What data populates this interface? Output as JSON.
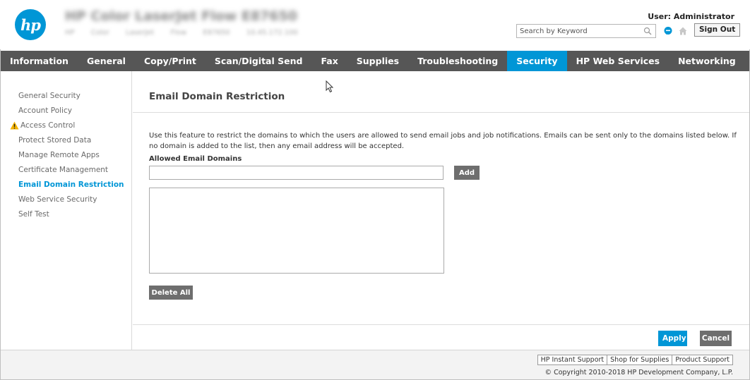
{
  "header": {
    "logo_text": "hp",
    "device_name": "HP Color LaserJet Flow E87650",
    "device_subtitle": "HP Color LaserJet Flow E87650     10.45.172.100",
    "user_label": "User: Administrator",
    "search_placeholder": "Search by Keyword",
    "sign_out": "Sign Out"
  },
  "nav": {
    "tabs": [
      {
        "label": "Information"
      },
      {
        "label": "General"
      },
      {
        "label": "Copy/Print"
      },
      {
        "label": "Scan/Digital Send"
      },
      {
        "label": "Fax"
      },
      {
        "label": "Supplies"
      },
      {
        "label": "Troubleshooting"
      },
      {
        "label": "Security",
        "active": true
      },
      {
        "label": "HP Web Services"
      },
      {
        "label": "Networking"
      }
    ]
  },
  "sidebar": {
    "items": [
      {
        "label": "General Security"
      },
      {
        "label": "Account Policy"
      },
      {
        "label": "Access Control",
        "warning": true
      },
      {
        "label": "Protect Stored Data"
      },
      {
        "label": "Manage Remote Apps"
      },
      {
        "label": "Certificate Management"
      },
      {
        "label": "Email Domain Restriction",
        "active": true
      },
      {
        "label": "Web Service Security"
      },
      {
        "label": "Self Test"
      }
    ]
  },
  "main": {
    "title": "Email Domain Restriction",
    "description": "Use this feature to restrict the domains to which the users are allowed to send email jobs and job notifications. Emails can be sent only to the domains listed below. If no domain is added to the list, then any email address will be accepted.",
    "field_label": "Allowed Email Domains",
    "domain_input_value": "",
    "add_label": "Add",
    "domains": [],
    "delete_all_label": "Delete All",
    "apply_label": "Apply",
    "cancel_label": "Cancel"
  },
  "footer": {
    "links": [
      "HP Instant Support",
      "Shop for Supplies",
      "Product Support"
    ],
    "copyright": "© Copyright 2010-2018 HP Development Company, L.P."
  },
  "colors": {
    "accent": "#0096d6",
    "nav_bg": "#565656",
    "button_gray": "#6e6e6e"
  }
}
